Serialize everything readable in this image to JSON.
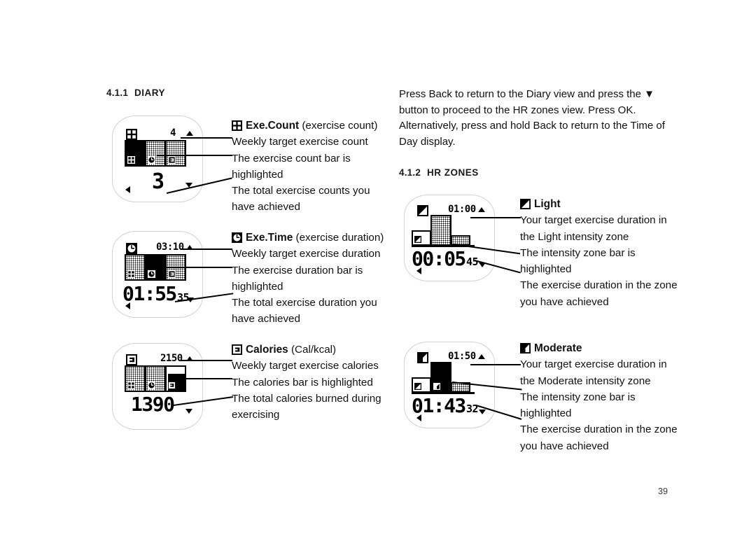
{
  "page": {
    "number": "39"
  },
  "sections": {
    "diary": {
      "number": "4.1.1",
      "title": "DIARY"
    },
    "hrzones": {
      "number": "4.1.2",
      "title": "HR ZONES"
    }
  },
  "intro_paragraph": {
    "lines": [
      "Press Back to return to the Diary view and press the ▼",
      "button to proceed to the HR zones view. Press OK.",
      "Alternatively, press and hold Back to return to the Time of",
      "Day display."
    ]
  },
  "annotations": {
    "exe_count": {
      "icon": "exe-count-icon",
      "label": "Exe.Count",
      "label_suffix": "(exercise count)",
      "lines": [
        "Weekly target exercise count",
        "The exercise count bar is",
        "highlighted",
        "The total exercise counts you",
        "have achieved"
      ]
    },
    "exe_time": {
      "icon": "exe-time-icon",
      "label": "Exe.Time",
      "label_suffix": "(exercise duration)",
      "lines": [
        "Weekly target exercise duration",
        "The exercise duration bar is",
        "highlighted",
        "The total exercise duration you",
        "have achieved"
      ]
    },
    "calories": {
      "icon": "calories-icon",
      "label": "Calories",
      "label_suffix": "(Cal/kcal)",
      "lines": [
        "Weekly target exercise calories",
        "The calories bar is highlighted",
        "The total calories burned during",
        "exercising"
      ]
    },
    "light": {
      "icon": "light-zone-icon",
      "label": "Light",
      "label_suffix": "",
      "lines": [
        "Your target exercise duration in",
        "the Light intensity zone",
        "The intensity zone bar is",
        "highlighted",
        "The exercise duration in the zone",
        "you have achieved"
      ]
    },
    "moderate": {
      "icon": "moderate-zone-icon",
      "label": "Moderate",
      "label_suffix": "",
      "lines": [
        "Your target exercise duration in",
        "the Moderate intensity zone",
        "The intensity zone bar is",
        "highlighted",
        "The exercise duration in the zone",
        "you have achieved"
      ]
    }
  },
  "watch_displays": {
    "exe_count": {
      "mode_icon": "exe-count-icon",
      "target_value": "4",
      "total_value": "3",
      "highlighted_bar_index": 0,
      "bar_icons": [
        "exe-count-icon",
        "exe-time-icon",
        "calories-icon"
      ],
      "up_arrow": true,
      "down_arrow": true,
      "left_arrow": true
    },
    "exe_time": {
      "mode_icon": "exe-time-icon",
      "target_value": "03:10",
      "total_value": "01:55",
      "total_seconds": "35",
      "highlighted_bar_index": 1,
      "bar_icons": [
        "exe-count-icon",
        "exe-time-icon",
        "calories-icon"
      ],
      "up_arrow": true,
      "down_arrow": true,
      "left_arrow": true
    },
    "calories": {
      "mode_icon": "calories-icon",
      "target_value": "2150",
      "total_value": "1390",
      "highlighted_bar_index": 2,
      "bar_icons": [
        "exe-count-icon",
        "exe-time-icon",
        "calories-icon"
      ],
      "up_arrow": true,
      "down_arrow": true,
      "left_arrow": false
    },
    "light": {
      "mode_icon": "light-zone-icon",
      "target_value": "01:00",
      "total_value": "00:05",
      "total_seconds": "45",
      "highlighted_zone_index": 1,
      "up_arrow": true,
      "down_arrow": true,
      "left_arrow": true
    },
    "moderate": {
      "mode_icon": "moderate-zone-icon",
      "target_value": "01:50",
      "total_value": "01:43",
      "total_seconds": "32",
      "highlighted_zone_index": 1,
      "up_arrow": true,
      "down_arrow": true,
      "left_arrow": true
    }
  }
}
